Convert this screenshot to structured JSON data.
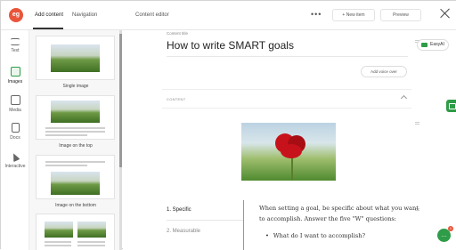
{
  "brand": {
    "logo_text": "eg"
  },
  "tabs": [
    {
      "label": "Add content",
      "active": true
    },
    {
      "label": "Navigation",
      "active": false
    }
  ],
  "toolbar": {
    "editor_label": "Content editor",
    "more_label": "•••",
    "new_item_label": "+ New item",
    "preview_label": "Preview"
  },
  "rail": {
    "items": [
      {
        "label": "Text",
        "icon": "text-icon",
        "active": false
      },
      {
        "label": "Images",
        "icon": "image-icon",
        "active": true
      },
      {
        "label": "Media",
        "icon": "media-icon",
        "active": false
      },
      {
        "label": "Docs",
        "icon": "document-icon",
        "active": false
      },
      {
        "label": "Interactive",
        "icon": "cursor-icon",
        "active": false
      }
    ]
  },
  "thumbnails": [
    {
      "caption": "Single image"
    },
    {
      "caption": "Image on the top"
    },
    {
      "caption": "Image on the bottom"
    },
    {
      "caption": ""
    }
  ],
  "content": {
    "title_label": "Content title",
    "title": "How to write SMART goals",
    "voice_button": "Add voice over",
    "section_label": "CONTENT"
  },
  "toc": [
    {
      "label": "1. Specific",
      "active": true
    },
    {
      "label": "2. Measurable",
      "active": false
    }
  ],
  "body": {
    "paragraph": "When setting a goal, be specific about what you want to accomplish. Answer the five \"W\" questions:",
    "bullet": "What do I want to accomplish?"
  },
  "assistant": {
    "label": "EasyAI"
  },
  "chat": {
    "badge": "1"
  },
  "colors": {
    "brand": "#e9553a",
    "accent": "#2e9c48",
    "toc_accent": "#e37b52"
  }
}
